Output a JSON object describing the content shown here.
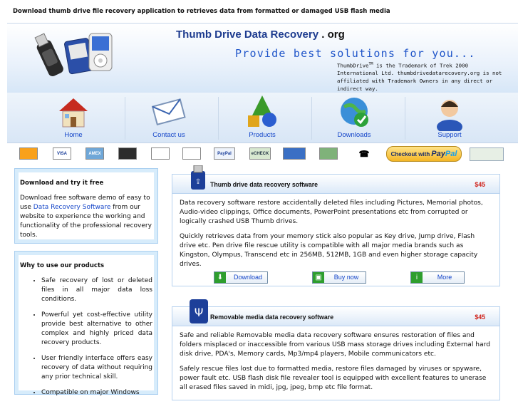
{
  "top_bar": {
    "text": "Download thumb drive file recovery application to retrieves data from formatted or damaged USB flash media"
  },
  "header": {
    "title": "Thumb Drive Data Recovery",
    "title_suffix": ". org",
    "tagline": "Provide best solutions for you...",
    "disclaimer_pre": "ThumbDrive",
    "disclaimer_tm": "TM",
    "disclaimer_post": " is the Trademark of Trek 2000 International Ltd. thumbdrivedatarecovery.org is not affiliated with Trademark Owners in any direct or indirect way."
  },
  "nav": [
    {
      "label": "Home",
      "icon": "house-icon"
    },
    {
      "label": "Contact us",
      "icon": "envelope-icon"
    },
    {
      "label": "Products",
      "icon": "shapes-icon"
    },
    {
      "label": "Downloads",
      "icon": "globe-check-icon"
    },
    {
      "label": "Support",
      "icon": "support-person-icon"
    }
  ],
  "payments": {
    "cards": [
      "MasterCard",
      "VISA",
      "AMEX",
      "",
      "",
      "",
      "PayPal",
      "eCHECK",
      "",
      "",
      "",
      ""
    ],
    "checkout_prefix": "Checkout with",
    "checkout_brand_a": "Pay",
    "checkout_brand_b": "Pal"
  },
  "sidebar": {
    "download": {
      "title": "Download and try it free",
      "text_before": "Download free software demo of easy to use ",
      "link": "Data Recovery Software",
      "text_after": " from our website to experience the working and functionality of the professional recovery tools."
    },
    "why": {
      "title": "Why to use our products",
      "items": [
        "Safe recovery of lost or deleted files in all major data loss conditions.",
        "Powerful yet cost-effective utility provide best alternative to other complex and highly priced data recovery products.",
        "User friendly interface offers easy recovery of data without requiring any prior technical skill.",
        "Compatible on major Windows"
      ]
    }
  },
  "products": [
    {
      "name": "Thumb drive data recovery software",
      "price": "$45",
      "paragraphs": [
        "Data recovery software restore accidentally deleted files including Pictures, Memorial photos, Audio-video clippings, Office documents, PowerPoint presentations etc from corrupted or logically crashed USB Thumb drives.",
        "Quickly retrieves data from your memory stick also popular as Key drive, Jump drive, Flash drive etc. Pen drive file rescue utility is compatible with all major media brands such as Kingston, Olympus, Transcend etc in 256MB, 512MB, 1GB and even higher storage capacity drives."
      ],
      "buttons": {
        "download": "Download",
        "buy": "Buy now",
        "more": "More"
      }
    },
    {
      "name": "Removable media data recovery software",
      "price": "$45",
      "paragraphs": [
        "Safe and reliable Removable media data recovery software ensures restoration of files and folders misplaced or inaccessible from various USB mass storage drives including External hard disk drive, PDA's, Memory cards, Mp3/mp4 players, Mobile communicators etc.",
        "Safely rescue files lost due to formatted media, restore files damaged by viruses or spyware, power fault etc. USB flash disk file revealer tool is equipped with excellent features to unerase all erased files saved in midi, jpg, jpeg, bmp etc file format."
      ]
    }
  ],
  "colors": {
    "link": "#1546c9",
    "price": "#d0231b",
    "title": "#1d3b8f",
    "tagline": "#1f55c9"
  }
}
